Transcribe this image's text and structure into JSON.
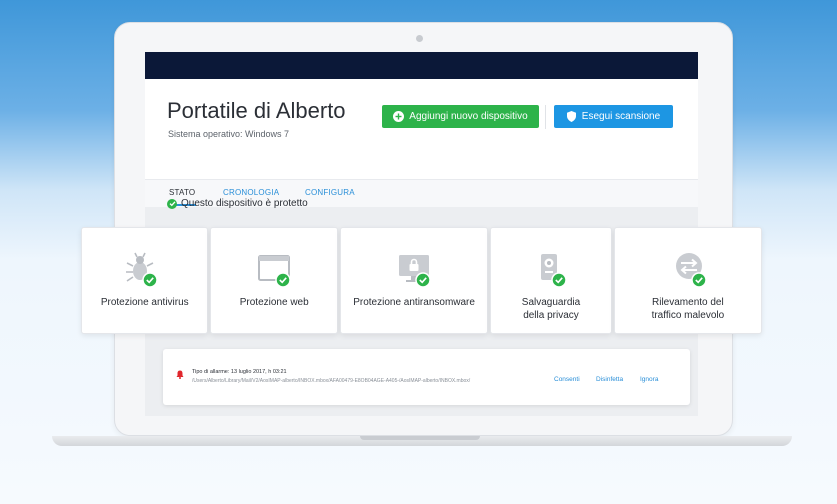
{
  "device": {
    "title": "Portatile di Alberto",
    "os_label": "Sistema operativo: Windows 7"
  },
  "actions": {
    "add_device": "Aggiungi nuovo dispositivo",
    "scan": "Esegui scansione"
  },
  "tabs": [
    {
      "label": "STATO",
      "active": true
    },
    {
      "label": "CRONOLOGIA",
      "active": false
    },
    {
      "label": "CONFIGURA",
      "active": false
    }
  ],
  "status": {
    "text": "Questo dispositivo è protetto",
    "icon": "check-circle-icon"
  },
  "features": [
    {
      "label": "Protezione antivirus",
      "icon": "bug-icon"
    },
    {
      "label": "Protezione web",
      "icon": "browser-window-icon"
    },
    {
      "label": "Protezione antiransomware",
      "icon": "locked-monitor-icon"
    },
    {
      "label_line1": "Salvaguardia",
      "label_line2": "della privacy",
      "icon": "webcam-icon"
    },
    {
      "label_line1": "Rilevamento del",
      "label_line2": "traffico malevolo",
      "icon": "traffic-arrows-icon"
    }
  ],
  "alert": {
    "type": "Tipo di allarme: 13 luglio 2017, h 03:21",
    "path": "/Users/Alberto/Library/Mail/V2/AosIMAP-alberto/INBOX.mbox/AFA00479-E8OB04AGE-A405-/AosIMAP-alberto/INBOX.mbox/",
    "actions": [
      "Consenti",
      "Disinfetta",
      "Ignora"
    ]
  },
  "colors": {
    "topbar": "#0b1838",
    "success": "#2db34a",
    "primary": "#1d96e3",
    "link": "#2a8fd8",
    "alert": "#e0262c"
  }
}
